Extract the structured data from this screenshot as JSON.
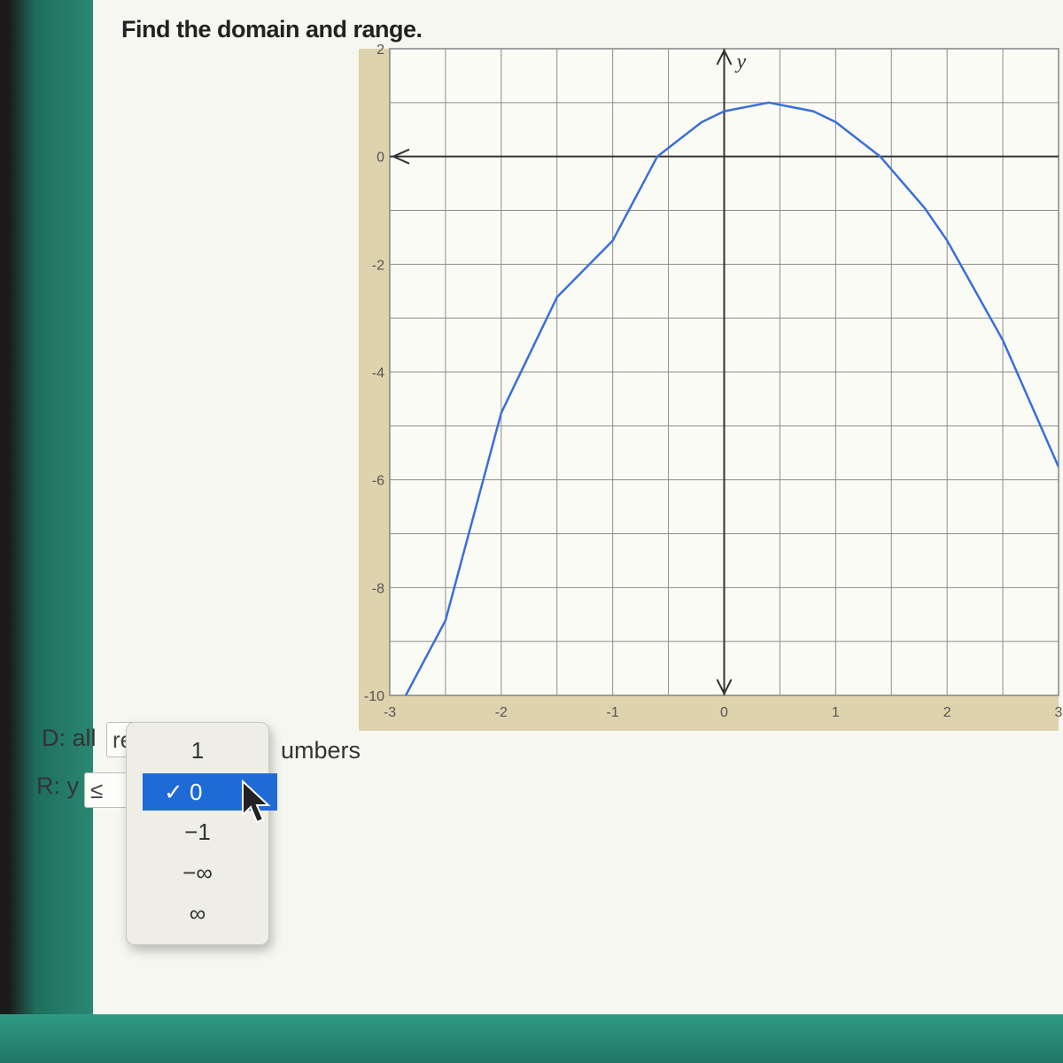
{
  "question": {
    "title": "Find the domain and range."
  },
  "chart_data": {
    "type": "line",
    "function": "downward-opening parabola",
    "vertex": [
      0.4,
      1
    ],
    "x_intercepts": [
      -0.6,
      1.4
    ],
    "xlim": [
      -3,
      3
    ],
    "ylim": [
      -10,
      2
    ],
    "x_ticks": [
      "-3",
      "-2",
      "-1",
      "0",
      "1",
      "2",
      "3"
    ],
    "y_ticks": [
      "2",
      "0",
      "-2",
      "-4",
      "-6",
      "-8",
      "-10"
    ],
    "axis_label_y": "y",
    "grid": true,
    "series": [
      {
        "color": "#3a6fd8",
        "x": [
          -3.0,
          -2.5,
          -2.0,
          -1.5,
          -1.0,
          -0.6,
          -0.2,
          0.0,
          0.4,
          0.8,
          1.0,
          1.4,
          1.8,
          2.0,
          2.5,
          3.0
        ],
        "y": [
          -10.56,
          -8.61,
          -4.76,
          -2.61,
          -1.56,
          0.0,
          0.64,
          0.84,
          1.0,
          0.84,
          0.64,
          0.0,
          -0.96,
          -1.56,
          -3.41,
          -5.76
        ]
      }
    ]
  },
  "answers": {
    "domain_label": "D: all",
    "domain_value": "re",
    "domain_suffix": "umbers",
    "range_label": "R: y",
    "range_operator": "≤",
    "dropdown_options": [
      "1",
      "✓ 0",
      "−1",
      "−∞",
      "∞"
    ],
    "dropdown_selected_index": 1
  },
  "colors": {
    "curve": "#3a6fd8",
    "selection": "#1f6bd6",
    "axis_strip": "#ddd3ad"
  }
}
